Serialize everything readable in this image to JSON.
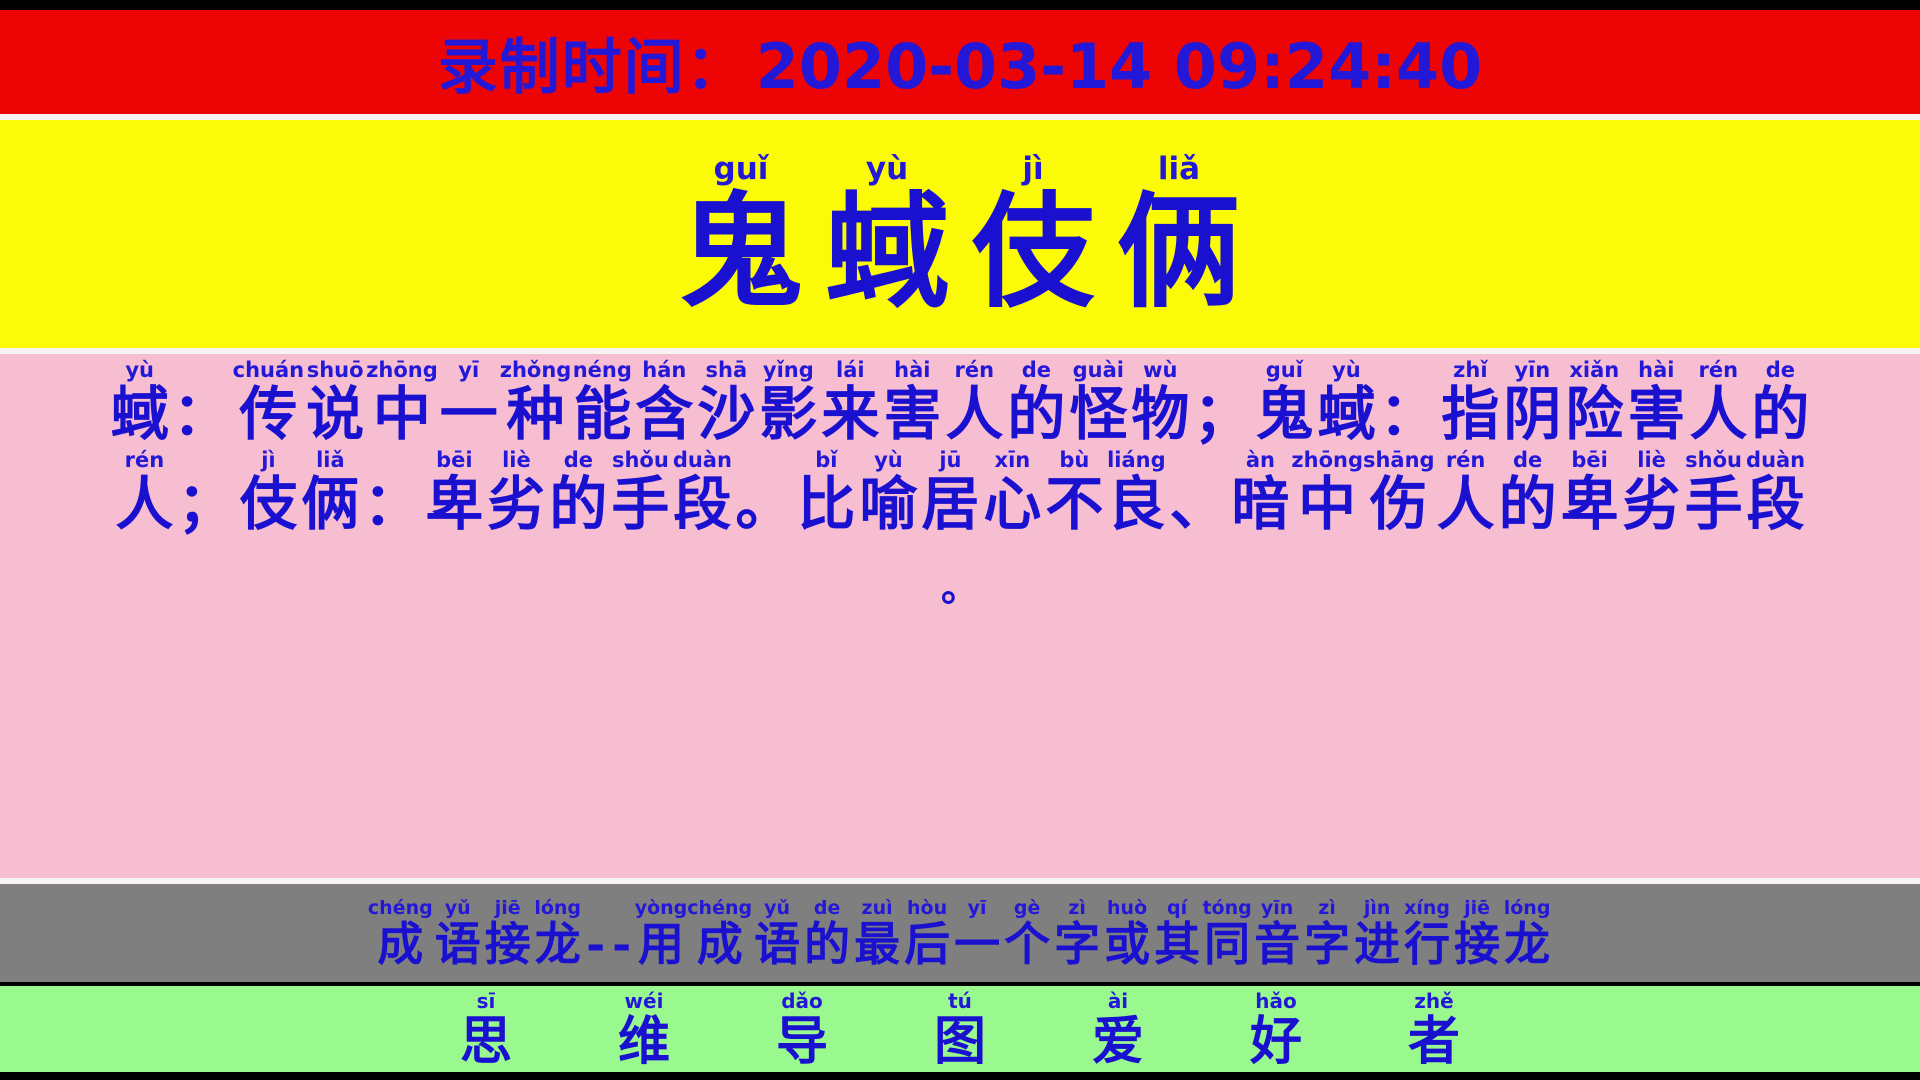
{
  "colors": {
    "timestamp_bar": "#ed0505",
    "title_bar": "#fbfb07",
    "definition_bar": "#f7bdd0",
    "rule_bar": "#807f7f",
    "brand_bar": "#99f98e",
    "text_blue": "#2418d8",
    "frame_black": "#000000"
  },
  "recording": {
    "label": "录制时间：",
    "timestamp": "2020-03-14 09:24:40"
  },
  "idiom": {
    "text": "鬼蜮伎俩",
    "pinyin": "guǐ yù jì liǎ",
    "chars": [
      {
        "hz": "鬼",
        "py": "guǐ"
      },
      {
        "hz": "蜮",
        "py": "yù"
      },
      {
        "hz": "伎",
        "py": "jì"
      },
      {
        "hz": "俩",
        "py": "liǎ"
      }
    ]
  },
  "definition": {
    "full_text": "蜮：传说中一种能含沙影来害人的怪物；鬼蜮：指阴险害人的人；伎俩：卑劣的手段。比喻居心不良、暗中伤人的卑劣手段。",
    "lines": [
      {
        "chars": [
          {
            "hz": "蜮",
            "py": "yù"
          },
          {
            "hz": "：",
            "py": ""
          },
          {
            "hz": "传",
            "py": "chuán"
          },
          {
            "hz": "说",
            "py": "shuō"
          },
          {
            "hz": "中",
            "py": "zhōng"
          },
          {
            "hz": "一",
            "py": "yī"
          },
          {
            "hz": "种",
            "py": "zhǒng"
          },
          {
            "hz": "能",
            "py": "néng"
          },
          {
            "hz": "含",
            "py": "hán"
          },
          {
            "hz": "沙",
            "py": "shā"
          },
          {
            "hz": "影",
            "py": "yǐng"
          },
          {
            "hz": "来",
            "py": "lái"
          },
          {
            "hz": "害",
            "py": "hài"
          },
          {
            "hz": "人",
            "py": "rén"
          },
          {
            "hz": "的",
            "py": "de"
          },
          {
            "hz": "怪",
            "py": "guài"
          },
          {
            "hz": "物",
            "py": "wù"
          },
          {
            "hz": "；",
            "py": ""
          },
          {
            "hz": "鬼",
            "py": "guǐ"
          },
          {
            "hz": "蜮",
            "py": "yù"
          },
          {
            "hz": "：",
            "py": ""
          },
          {
            "hz": "指",
            "py": "zhǐ"
          },
          {
            "hz": "阴",
            "py": "yīn"
          },
          {
            "hz": "险",
            "py": "xiǎn"
          },
          {
            "hz": "害",
            "py": "hài"
          },
          {
            "hz": "人",
            "py": "rén"
          },
          {
            "hz": "的",
            "py": "de"
          }
        ]
      },
      {
        "chars": [
          {
            "hz": "人",
            "py": "rén"
          },
          {
            "hz": "；",
            "py": ""
          },
          {
            "hz": "伎",
            "py": "jì"
          },
          {
            "hz": "俩",
            "py": "liǎ"
          },
          {
            "hz": "：",
            "py": ""
          },
          {
            "hz": "卑",
            "py": "bēi"
          },
          {
            "hz": "劣",
            "py": "liè"
          },
          {
            "hz": "的",
            "py": "de"
          },
          {
            "hz": "手",
            "py": "shǒu"
          },
          {
            "hz": "段",
            "py": "duàn"
          },
          {
            "hz": "。",
            "py": ""
          },
          {
            "hz": "比",
            "py": "bǐ"
          },
          {
            "hz": "喻",
            "py": "yù"
          },
          {
            "hz": "居",
            "py": "jū"
          },
          {
            "hz": "心",
            "py": "xīn"
          },
          {
            "hz": "不",
            "py": "bù"
          },
          {
            "hz": "良",
            "py": "liáng"
          },
          {
            "hz": "、",
            "py": ""
          },
          {
            "hz": "暗",
            "py": "àn"
          },
          {
            "hz": "中",
            "py": "zhōng"
          },
          {
            "hz": "伤",
            "py": "shāng"
          },
          {
            "hz": "人",
            "py": "rén"
          },
          {
            "hz": "的",
            "py": "de"
          },
          {
            "hz": "卑",
            "py": "bēi"
          },
          {
            "hz": "劣",
            "py": "liè"
          },
          {
            "hz": "手",
            "py": "shǒu"
          },
          {
            "hz": "段",
            "py": "duàn"
          }
        ]
      },
      {
        "chars": [
          {
            "hz": "。",
            "py": ""
          }
        ]
      }
    ]
  },
  "rule": {
    "full_text": "成语接龙--用成语的最后一个字或其同音字进行接龙",
    "chars": [
      {
        "hz": "成",
        "py": "chéng"
      },
      {
        "hz": "语",
        "py": "yǔ"
      },
      {
        "hz": "接",
        "py": "jiē"
      },
      {
        "hz": "龙",
        "py": "lóng"
      },
      {
        "hz": "-",
        "py": ""
      },
      {
        "hz": "-",
        "py": ""
      },
      {
        "hz": "用",
        "py": "yòng"
      },
      {
        "hz": "成",
        "py": "chéng"
      },
      {
        "hz": "语",
        "py": "yǔ"
      },
      {
        "hz": "的",
        "py": "de"
      },
      {
        "hz": "最",
        "py": "zuì"
      },
      {
        "hz": "后",
        "py": "hòu"
      },
      {
        "hz": "一",
        "py": "yī"
      },
      {
        "hz": "个",
        "py": "gè"
      },
      {
        "hz": "字",
        "py": "zì"
      },
      {
        "hz": "或",
        "py": "huò"
      },
      {
        "hz": "其",
        "py": "qí"
      },
      {
        "hz": "同",
        "py": "tóng"
      },
      {
        "hz": "音",
        "py": "yīn"
      },
      {
        "hz": "字",
        "py": "zì"
      },
      {
        "hz": "进",
        "py": "jìn"
      },
      {
        "hz": "行",
        "py": "xíng"
      },
      {
        "hz": "接",
        "py": "jiē"
      },
      {
        "hz": "龙",
        "py": "lóng"
      }
    ]
  },
  "brand": {
    "full_text": "思维导图爱好者",
    "chars": [
      {
        "hz": "思",
        "py": "sī"
      },
      {
        "hz": "维",
        "py": "wéi"
      },
      {
        "hz": "导",
        "py": "dǎo"
      },
      {
        "hz": "图",
        "py": "tú"
      },
      {
        "hz": "爱",
        "py": "ài"
      },
      {
        "hz": "好",
        "py": "hǎo"
      },
      {
        "hz": "者",
        "py": "zhě"
      }
    ]
  }
}
